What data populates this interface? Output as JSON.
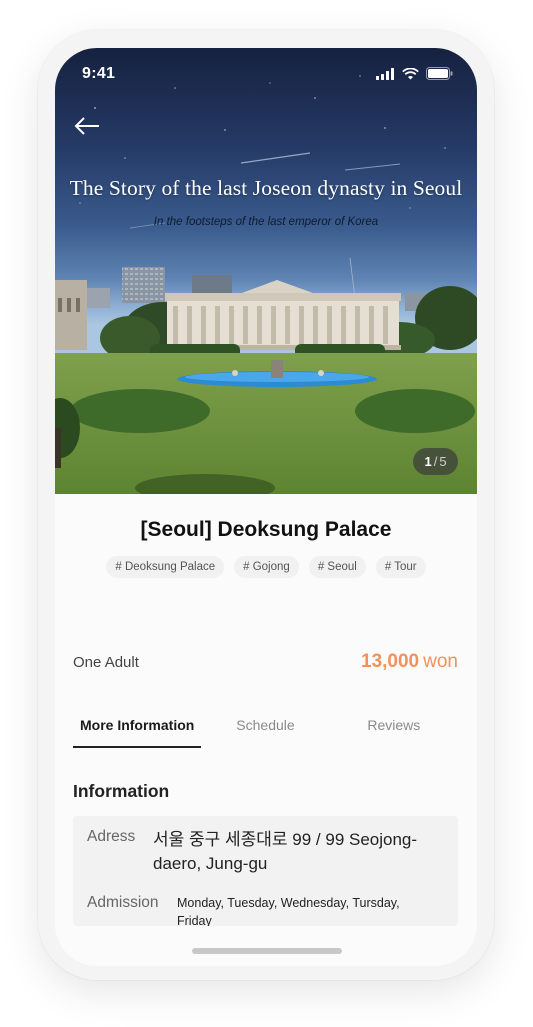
{
  "status": {
    "time": "9:41"
  },
  "hero": {
    "title": "The Story of the last Joseon dynasty in Seoul",
    "subtitle": "In the footsteps of the last emperor of Korea",
    "page_current": "1",
    "page_separator": "/",
    "page_total": "5"
  },
  "tour": {
    "title": "[Seoul] Deoksung Palace",
    "tags": [
      "# Deoksung Palace",
      "# Gojong",
      "# Seoul",
      "# Tour"
    ]
  },
  "price": {
    "label": "One Adult",
    "amount": "13,000",
    "unit": "won"
  },
  "tabs": [
    {
      "label": "More Information",
      "active": true
    },
    {
      "label": "Schedule",
      "active": false
    },
    {
      "label": "Reviews",
      "active": false
    }
  ],
  "info": {
    "section_title": "Information",
    "rows": [
      {
        "key": "Adress",
        "value": "서울 중구 세종대로 99 / 99 Seojong-daero, Jung-gu"
      },
      {
        "key": "Admission",
        "value": "Monday, Tuesday, Wednesday, Tursday, Friday"
      }
    ]
  },
  "colors": {
    "accent": "#f2925a",
    "tab_active": "#1b1b1b",
    "tag_bg": "#f1f1f1"
  },
  "icons": [
    "back-arrow-icon",
    "signal-icon",
    "wifi-icon",
    "battery-icon"
  ]
}
